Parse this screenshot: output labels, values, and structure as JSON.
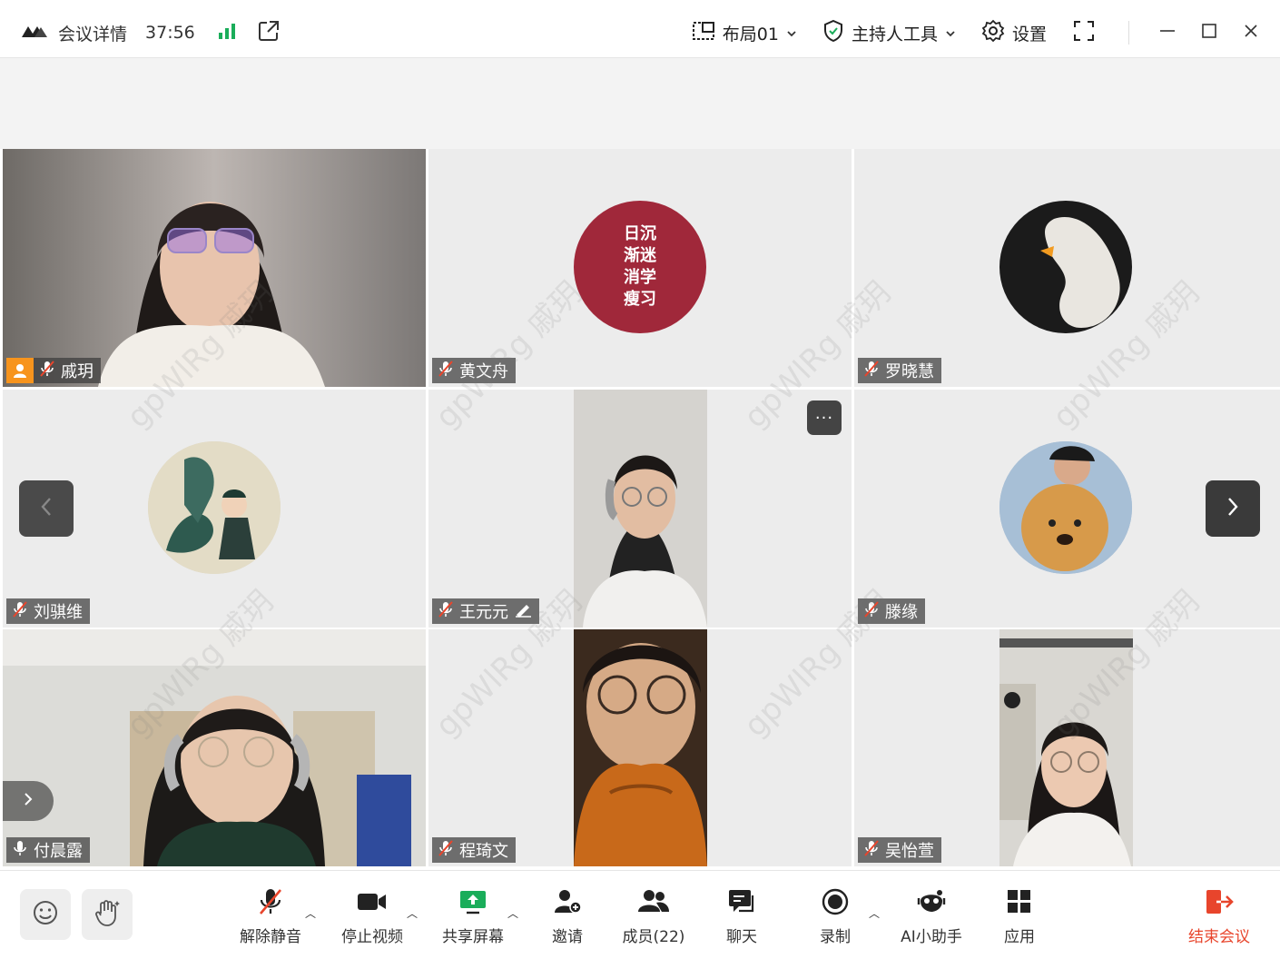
{
  "titlebar": {
    "title": "会议详情",
    "timer": "37:56",
    "layout_label": "布局01",
    "host_tools_label": "主持人工具",
    "settings_label": "设置"
  },
  "participants": [
    {
      "name": "戚玥",
      "is_host": true
    },
    {
      "name": "黄文舟",
      "avatar_text": "日沉 渐迷 消学 瘦习"
    },
    {
      "name": "罗晓慧"
    },
    {
      "name": "刘骐维"
    },
    {
      "name": "王元元"
    },
    {
      "name": "滕缘"
    },
    {
      "name": "付晨露"
    },
    {
      "name": "程琦文"
    },
    {
      "name": "吴怡萱"
    }
  ],
  "avatar_text_lines": [
    "日沉",
    "渐迷",
    "消学",
    "瘦习"
  ],
  "watermark": "gpWlRg 戚玥",
  "more_label": "···",
  "toolbar": {
    "unmute": "解除静音",
    "stop_video": "停止视频",
    "share_screen": "共享屏幕",
    "invite": "邀请",
    "members": "成员(22)",
    "chat": "聊天",
    "record": "录制",
    "ai_assistant": "AI小助手",
    "apps": "应用",
    "end_meeting": "结束会议"
  },
  "colors": {
    "accent_green": "#1aad5a",
    "end_red": "#e8452c",
    "host_orange": "#f7941d",
    "avatar_red": "#a0283a"
  }
}
